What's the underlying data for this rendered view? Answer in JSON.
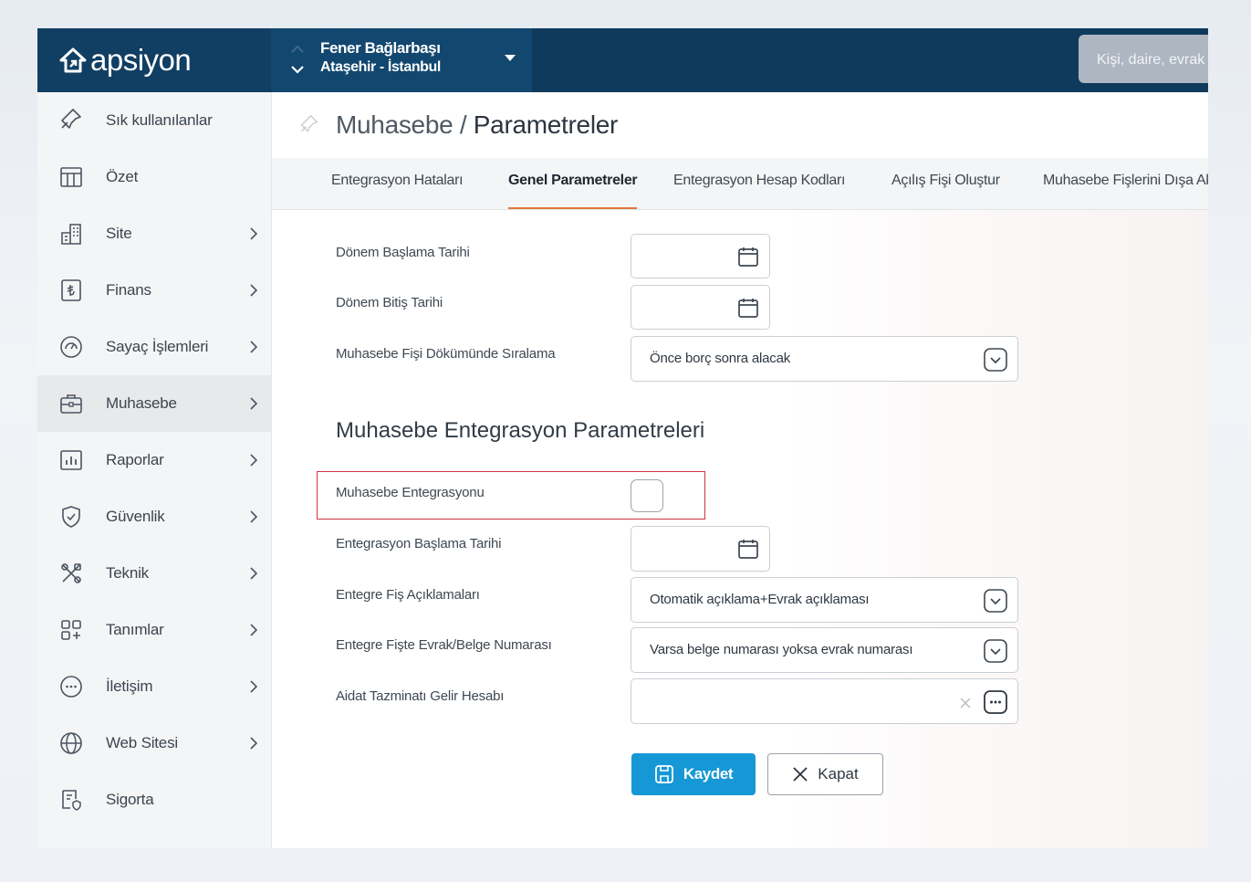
{
  "brand": {
    "name": "apsiyon"
  },
  "site": {
    "name": "Fener Bağlarbaşı",
    "location": "Ataşehir - İstanbul"
  },
  "search": {
    "placeholder": "Kişi, daire, evrak"
  },
  "sidebar": {
    "items": [
      {
        "label": "Sık kullanılanlar",
        "icon": "pin-icon",
        "chevron": false,
        "active": false
      },
      {
        "label": "Özet",
        "icon": "table-icon",
        "chevron": false,
        "active": false
      },
      {
        "label": "Site",
        "icon": "building-icon",
        "chevron": true,
        "active": false
      },
      {
        "label": "Finans",
        "icon": "lira-icon",
        "chevron": true,
        "active": false
      },
      {
        "label": "Sayaç İşlemleri",
        "icon": "gauge-icon",
        "chevron": true,
        "active": false
      },
      {
        "label": "Muhasebe",
        "icon": "briefcase-icon",
        "chevron": true,
        "active": true
      },
      {
        "label": "Raporlar",
        "icon": "bar-chart-icon",
        "chevron": true,
        "active": false
      },
      {
        "label": "Güvenlik",
        "icon": "shield-icon",
        "chevron": true,
        "active": false
      },
      {
        "label": "Teknik",
        "icon": "tools-icon",
        "chevron": true,
        "active": false
      },
      {
        "label": "Tanımlar",
        "icon": "grid-plus-icon",
        "chevron": true,
        "active": false
      },
      {
        "label": "İletişim",
        "icon": "chat-icon",
        "chevron": true,
        "active": false
      },
      {
        "label": "Web Sitesi",
        "icon": "globe-icon",
        "chevron": true,
        "active": false
      },
      {
        "label": "Sigorta",
        "icon": "document-icon",
        "chevron": false,
        "active": false
      }
    ]
  },
  "page": {
    "breadcrumb": "Muhasebe / ",
    "title": "Parametreler"
  },
  "tabs": [
    {
      "label": "Entegrasyon Hataları",
      "active": false
    },
    {
      "label": "Genel Parametreler",
      "active": true
    },
    {
      "label": "Entegrasyon Hesap Kodları",
      "active": false
    },
    {
      "label": "Açılış Fişi Oluştur",
      "active": false
    },
    {
      "label": "Muhasebe Fişlerini Dışa Aktar",
      "active": false
    }
  ],
  "form": {
    "period_start_label": "Dönem Başlama Tarihi",
    "period_start_value": "",
    "period_end_label": "Dönem Bitiş Tarihi",
    "period_end_value": "",
    "sort_label": "Muhasebe Fişi Dökümünde Sıralama",
    "sort_value": "Önce borç sonra alacak",
    "section_title": "Muhasebe Entegrasyon Parametreleri",
    "integration_label": "Muhasebe Entegrasyonu",
    "integration_checked": false,
    "integration_start_label": "Entegrasyon Başlama Tarihi",
    "integration_start_value": "",
    "descriptions_label": "Entegre Fiş Açıklamaları",
    "descriptions_value": "Otomatik açıklama+Evrak açıklaması",
    "docnum_label": "Entegre Fişte Evrak/Belge Numarası",
    "docnum_value": "Varsa belge numarası yoksa evrak numarası",
    "dues_label": "Aidat Tazminatı Gelir Hesabı",
    "dues_value": ""
  },
  "actions": {
    "save": "Kaydet",
    "close": "Kapat"
  },
  "colors": {
    "topbar": "#0f3a5c",
    "primary": "#1798d6",
    "tab_underline": "#e0763a",
    "highlight": "#d2333f"
  }
}
